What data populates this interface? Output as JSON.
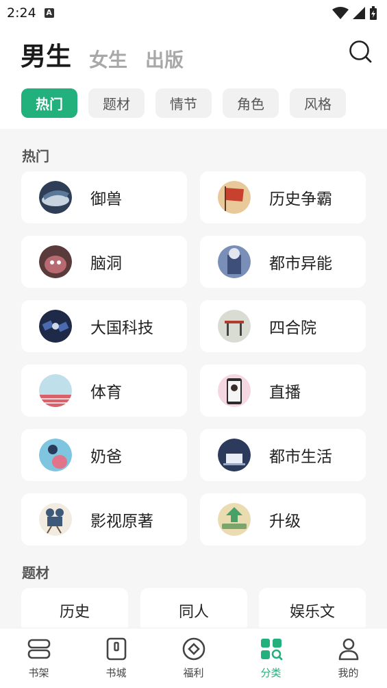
{
  "status_bar": {
    "time": "2:24"
  },
  "top_tabs": [
    {
      "label": "男生",
      "active": true
    },
    {
      "label": "女生",
      "active": false
    },
    {
      "label": "出版",
      "active": false
    }
  ],
  "chips": [
    {
      "label": "热门",
      "active": true
    },
    {
      "label": "题材",
      "active": false
    },
    {
      "label": "情节",
      "active": false
    },
    {
      "label": "角色",
      "active": false
    },
    {
      "label": "风格",
      "active": false
    }
  ],
  "section_hot": {
    "title": "热门",
    "items": [
      {
        "label": "御兽",
        "icon": "beast-taming-icon"
      },
      {
        "label": "历史争霸",
        "icon": "history-flag-icon"
      },
      {
        "label": "脑洞",
        "icon": "brain-hole-icon"
      },
      {
        "label": "都市异能",
        "icon": "urban-power-icon"
      },
      {
        "label": "大国科技",
        "icon": "satellite-icon"
      },
      {
        "label": "四合院",
        "icon": "courtyard-icon"
      },
      {
        "label": "体育",
        "icon": "stadium-icon"
      },
      {
        "label": "直播",
        "icon": "livestream-icon"
      },
      {
        "label": "奶爸",
        "icon": "dad-baby-icon"
      },
      {
        "label": "都市生活",
        "icon": "city-life-icon"
      },
      {
        "label": "影视原著",
        "icon": "film-camera-icon"
      },
      {
        "label": "升级",
        "icon": "level-up-icon"
      }
    ]
  },
  "section_theme": {
    "title": "题材",
    "items": [
      {
        "label": "历史"
      },
      {
        "label": "同人"
      },
      {
        "label": "娱乐文"
      }
    ]
  },
  "bottom_nav": [
    {
      "label": "书架",
      "icon": "bookshelf-icon",
      "active": false
    },
    {
      "label": "书城",
      "icon": "bookstore-icon",
      "active": false
    },
    {
      "label": "福利",
      "icon": "welfare-icon",
      "active": false
    },
    {
      "label": "分类",
      "icon": "category-icon",
      "active": true
    },
    {
      "label": "我的",
      "icon": "profile-icon",
      "active": false
    }
  ],
  "colors": {
    "accent": "#22b07d",
    "background": "#f6f6f6"
  }
}
